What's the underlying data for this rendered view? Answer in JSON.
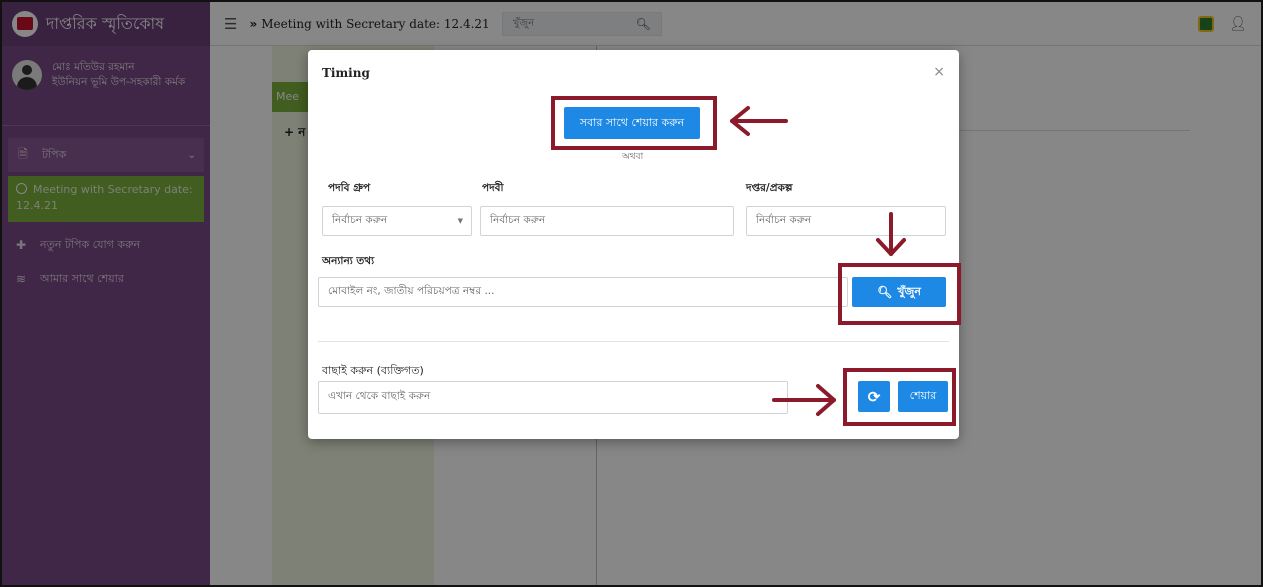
{
  "brand": {
    "title": "দাপ্তরিক স্মৃতিকোষ"
  },
  "user": {
    "name": "মোঃ মতিউর রহমান",
    "role": "ইউনিয়ন ভূমি উপ-সহকারী কর্মক"
  },
  "sidebar": {
    "items": [
      {
        "label": "টপিক",
        "icon": "document-icon"
      },
      {
        "label": "Meeting with Secretary date: 12.4.21",
        "icon": "circle-icon"
      },
      {
        "label": "নতুন টপিক যোগ করুন",
        "icon": "plus-icon"
      },
      {
        "label": "আমার সাথে শেয়ার",
        "icon": "layers-icon"
      }
    ]
  },
  "header": {
    "breadcrumb": "Meeting with Secretary date: 12.4.21",
    "search_placeholder": "খুঁজুন"
  },
  "background": {
    "tab_label": "Mee",
    "plus": "+ ন"
  },
  "modal": {
    "title": "Timing",
    "share_all_label": "সবার সাথে শেয়ার করুন",
    "or_text": "অথবা",
    "designation_group_label": "পদবি গ্রুপ",
    "designation_group_value": "নির্বাচন করুন",
    "designation_label": "পদবী",
    "designation_placeholder": "নির্বাচন করুন",
    "office_label": "দপ্তর/প্রকল্প",
    "office_placeholder": "নির্বাচন করুন",
    "other_info_label": "অন্যান্য তথ্য",
    "other_info_placeholder": "মোবাইল নং, জাতীয় পরিচয়পত্র নম্বর ...",
    "search_label": "খুঁজুন",
    "select_label": "বাছাই করুন (ব্যক্তিগত)",
    "select_placeholder": "এখান থেকে বাছাই করুন",
    "share_label": "শেয়ার"
  },
  "colors": {
    "sidebar": "#7a4a86",
    "active_item": "#7bb03b",
    "primary_button": "#1e88e5",
    "annotation": "#8b1a2a"
  }
}
